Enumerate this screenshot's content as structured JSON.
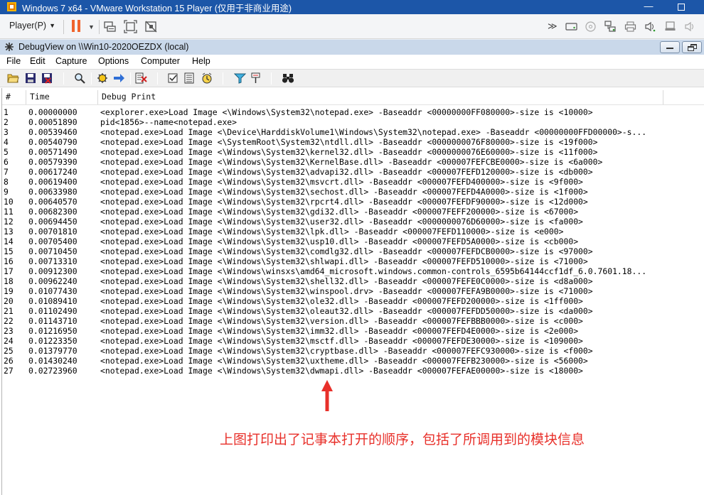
{
  "vmware": {
    "title": "Windows 7 x64 - VMware Workstation 15 Player (仅用于非商业用途)",
    "player_menu": "Player(P)",
    "minimize_label": "—",
    "close_label": "✕",
    "brand_color": "#1c56a8",
    "pause_color": "#f0642d"
  },
  "debugview": {
    "title": "DebugView on \\\\Win10-2020OEZDX (local)",
    "menu": [
      "File",
      "Edit",
      "Capture",
      "Options",
      "Computer",
      "Help"
    ]
  },
  "list": {
    "columns": [
      "#",
      "Time",
      "Debug Print"
    ],
    "rows": [
      {
        "num": "1",
        "time": "0.00000000",
        "msg": "<explorer.exe>Load Image <\\Windows\\System32\\notepad.exe> -Baseaddr <00000000FF080000>-size is <10000>"
      },
      {
        "num": "2",
        "time": "0.00051890",
        "msg": "pid<1856>--name<notepad.exe>"
      },
      {
        "num": "3",
        "time": "0.00539460",
        "msg": "<notepad.exe>Load Image <\\Device\\HarddiskVolume1\\Windows\\System32\\notepad.exe> -Baseaddr <00000000FFD00000>-s..."
      },
      {
        "num": "4",
        "time": "0.00540790",
        "msg": "<notepad.exe>Load Image <\\SystemRoot\\System32\\ntdll.dll> -Baseaddr <0000000076F80000>-size is <19f000>"
      },
      {
        "num": "5",
        "time": "0.00571490",
        "msg": "<notepad.exe>Load Image <\\Windows\\System32\\kernel32.dll> -Baseaddr <0000000076E60000>-size is <11f000>"
      },
      {
        "num": "6",
        "time": "0.00579390",
        "msg": "<notepad.exe>Load Image <\\Windows\\System32\\KernelBase.dll> -Baseaddr <000007FEFCBE0000>-size is <6a000>"
      },
      {
        "num": "7",
        "time": "0.00617240",
        "msg": "<notepad.exe>Load Image <\\Windows\\System32\\advapi32.dll> -Baseaddr <000007FEFD120000>-size is <db000>"
      },
      {
        "num": "8",
        "time": "0.00619400",
        "msg": "<notepad.exe>Load Image <\\Windows\\System32\\msvcrt.dll> -Baseaddr <000007FEFD400000>-size is <9f000>"
      },
      {
        "num": "9",
        "time": "0.00633980",
        "msg": "<notepad.exe>Load Image <\\Windows\\System32\\sechost.dll> -Baseaddr <000007FEFD4A0000>-size is <1f000>"
      },
      {
        "num": "10",
        "time": "0.00640570",
        "msg": "<notepad.exe>Load Image <\\Windows\\System32\\rpcrt4.dll> -Baseaddr <000007FEFDF90000>-size is <12d000>"
      },
      {
        "num": "11",
        "time": "0.00682300",
        "msg": "<notepad.exe>Load Image <\\Windows\\System32\\gdi32.dll> -Baseaddr <000007FEFF200000>-size is <67000>"
      },
      {
        "num": "12",
        "time": "0.00694450",
        "msg": "<notepad.exe>Load Image <\\Windows\\System32\\user32.dll> -Baseaddr <0000000076D60000>-size is <fa000>"
      },
      {
        "num": "13",
        "time": "0.00701810",
        "msg": "<notepad.exe>Load Image <\\Windows\\System32\\lpk.dll> -Baseaddr <000007FEFD110000>-size is <e000>"
      },
      {
        "num": "14",
        "time": "0.00705400",
        "msg": "<notepad.exe>Load Image <\\Windows\\System32\\usp10.dll> -Baseaddr <000007FEFD5A0000>-size is <cb000>"
      },
      {
        "num": "15",
        "time": "0.00710450",
        "msg": "<notepad.exe>Load Image <\\Windows\\System32\\comdlg32.dll> -Baseaddr <000007FEFDCB0000>-size is <97000>"
      },
      {
        "num": "16",
        "time": "0.00713310",
        "msg": "<notepad.exe>Load Image <\\Windows\\System32\\shlwapi.dll> -Baseaddr <000007FEFD510000>-size is <71000>"
      },
      {
        "num": "17",
        "time": "0.00912300",
        "msg": "<notepad.exe>Load Image <\\Windows\\winsxs\\amd64_microsoft.windows.common-controls_6595b64144ccf1df_6.0.7601.18..."
      },
      {
        "num": "18",
        "time": "0.00962240",
        "msg": "<notepad.exe>Load Image <\\Windows\\System32\\shell32.dll> -Baseaddr <000007FEFE0C0000>-size is <d8a000>"
      },
      {
        "num": "19",
        "time": "0.01077430",
        "msg": "<notepad.exe>Load Image <\\Windows\\System32\\winspool.drv> -Baseaddr <000007FEFA9B0000>-size is <71000>"
      },
      {
        "num": "20",
        "time": "0.01089410",
        "msg": "<notepad.exe>Load Image <\\Windows\\System32\\ole32.dll> -Baseaddr <000007FEFD200000>-size is <1ff000>"
      },
      {
        "num": "21",
        "time": "0.01102490",
        "msg": "<notepad.exe>Load Image <\\Windows\\System32\\oleaut32.dll> -Baseaddr <000007FEFDD50000>-size is <da000>"
      },
      {
        "num": "22",
        "time": "0.01143710",
        "msg": "<notepad.exe>Load Image <\\Windows\\System32\\version.dll> -Baseaddr <000007FEFBBB0000>-size is <c000>"
      },
      {
        "num": "23",
        "time": "0.01216950",
        "msg": "<notepad.exe>Load Image <\\Windows\\System32\\imm32.dll> -Baseaddr <000007FEFD4E0000>-size is <2e000>"
      },
      {
        "num": "24",
        "time": "0.01223350",
        "msg": "<notepad.exe>Load Image <\\Windows\\System32\\msctf.dll> -Baseaddr <000007FEFDE30000>-size is <109000>"
      },
      {
        "num": "25",
        "time": "0.01379770",
        "msg": "<notepad.exe>Load Image <\\Windows\\System32\\cryptbase.dll> -Baseaddr <000007FEFC930000>-size is <f000>"
      },
      {
        "num": "26",
        "time": "0.01430240",
        "msg": "<notepad.exe>Load Image <\\Windows\\System32\\uxtheme.dll> -Baseaddr <000007FEFB230000>-size is <56000>"
      },
      {
        "num": "27",
        "time": "0.02723960",
        "msg": "<notepad.exe>Load Image <\\Windows\\System32\\dwmapi.dll> -Baseaddr <000007FEFAE00000>-size is <18000>"
      }
    ]
  },
  "annotation": {
    "text": "上图打印出了记事本打开的顺序，包括了所调用到的模块信息",
    "color": "#e8302a"
  },
  "icons": {
    "vmware_toolbar": [
      "pause-icon",
      "send-ctrl-alt-del-icon",
      "full-screen-icon",
      "unity-icon",
      "more-icon",
      "hard-disk-icon",
      "cd-dvd-icon",
      "network-adapter-icon",
      "printer-icon",
      "sound-card-icon",
      "usb-icon",
      "speaker-icon"
    ],
    "debugview_toolbar": [
      "open-icon",
      "save-icon",
      "exit-icon",
      "find-icon",
      "capture-icon",
      "autoscroll-icon",
      "clear-icon",
      "filter-icon",
      "history-icon",
      "time-icon",
      "highlight-icon",
      "bookmark-icon",
      "binoculars-icon"
    ]
  }
}
